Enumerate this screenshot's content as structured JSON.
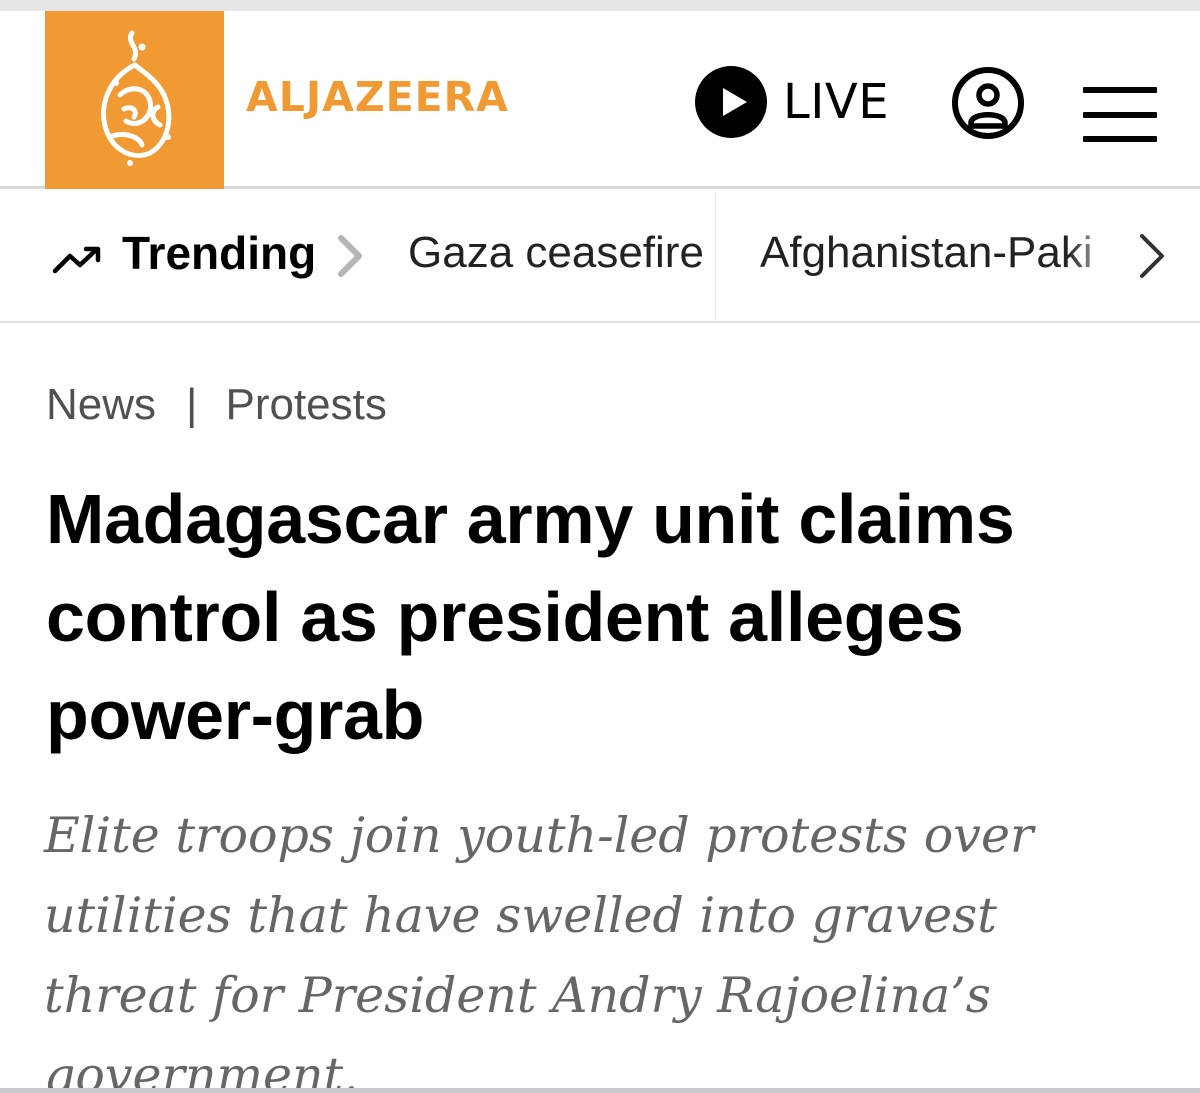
{
  "header": {
    "brand_name": "ALJAZEERA",
    "live_label": "LIVE",
    "brand_color": "#f19a33",
    "icons": [
      "aljazeera-logo",
      "play-icon",
      "account-icon",
      "menu-icon"
    ]
  },
  "trending": {
    "label": "Trending",
    "icons": [
      "trending-up-icon",
      "chevron-right-icon"
    ],
    "items": [
      {
        "label": "Gaza ceasefire"
      },
      {
        "label": "Afghanistan-Paki"
      }
    ]
  },
  "article": {
    "breadcrumb": {
      "section": "News",
      "separator": "|",
      "topic": "Protests"
    },
    "headline": "Madagascar army unit claims control as president alleges power-grab",
    "summary": "Elite troops join youth-led protests over utilities that have swelled into gravest threat for President Andry Rajoelina’s government."
  }
}
